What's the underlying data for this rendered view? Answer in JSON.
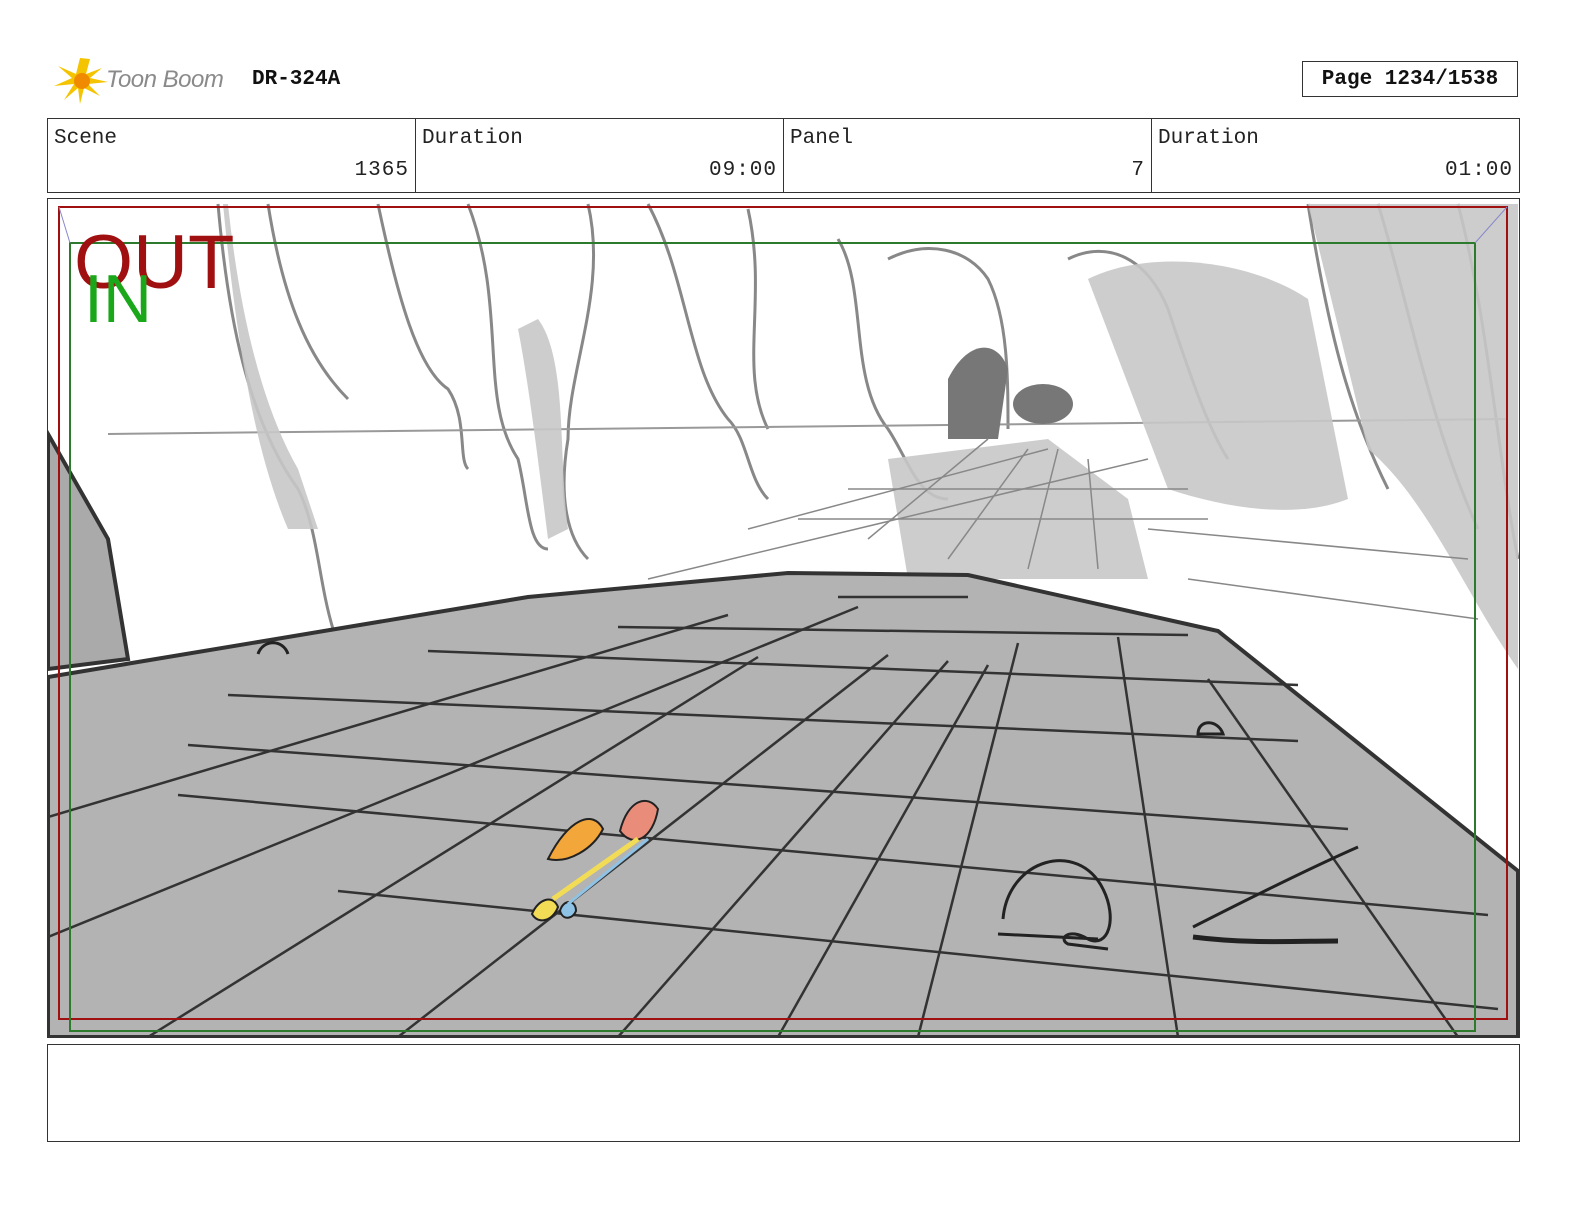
{
  "header": {
    "brand": "Toon Boom",
    "production_code": "DR-324A",
    "page_label": "Page 1234/1538"
  },
  "info": {
    "scene_label": "Scene",
    "scene_value": "1365",
    "scene_duration_label": "Duration",
    "scene_duration_value": "09:00",
    "panel_label": "Panel",
    "panel_value": "7",
    "panel_duration_label": "Duration",
    "panel_duration_value": "01:00"
  },
  "frame": {
    "out_label": "OUT",
    "in_label": "IN",
    "out_color": "#a01010",
    "in_color": "#1aa81a"
  },
  "notes": {
    "text": ""
  },
  "colors": {
    "ground_gray": "#b3b3b3",
    "rock_gray": "#c8c8c8",
    "brand_yellow": "#f5c400"
  }
}
